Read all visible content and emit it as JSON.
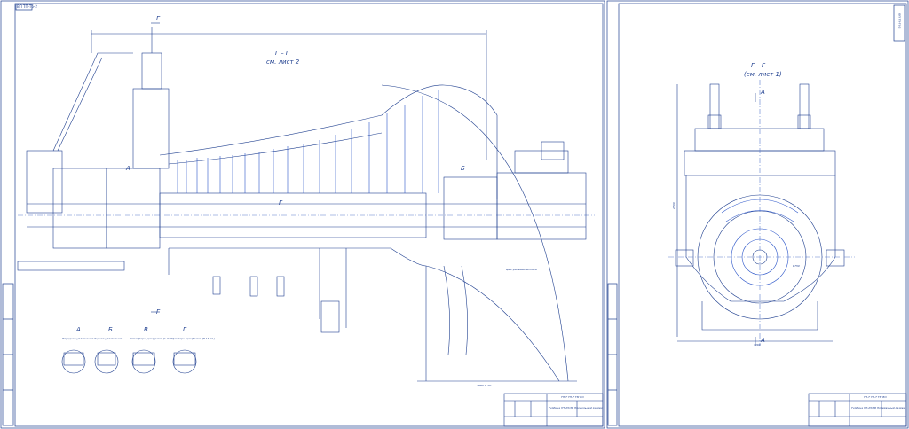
{
  "sheet1": {
    "top_code": "ВП ТП-Т6-2",
    "section_title_line1": "Г – Г",
    "section_title_line2": "см. лист 2",
    "section_marks": {
      "g_top": "Г",
      "g_bottom": "Г",
      "a": "А",
      "b": "Б",
      "g_mid": "Г"
    },
    "detail_labels": [
      {
        "letter": "А",
        "caption": "Переднее уплотнение"
      },
      {
        "letter": "Б",
        "caption": "Заднее уплотнение"
      },
      {
        "letter": "В",
        "caption": "Атмосферн. диафрагм. (1-7 ст.)"
      },
      {
        "letter": "Г",
        "caption": "Атмосферн. диафрагм. (8-16 ст.)"
      }
    ],
    "right_annotation": "Центральный шпонка",
    "dimension_bottom": "2880 ± 2%",
    "title_block": {
      "doc_code": "ТП-Т ТП-Т ТМ ВО",
      "name": "Турбина ПТ-25/3Б Продольный разрез"
    }
  },
  "sheet2": {
    "top_code": "ВП ТП-Т6-2",
    "section_title_line1": "Г – Г",
    "section_title_line2": "(см. лист 1)",
    "section_marks": {
      "a_top": "А",
      "a_bottom": "А"
    },
    "dimension_left": "2700",
    "dimension_bottom": "3060",
    "dimension_right": "R750",
    "title_block": {
      "doc_code": "ТП-Т ТП-Т ТМ ВО",
      "name": "Турбина ПТ-25/3Б Поперечный разрез"
    }
  },
  "colors": {
    "line": "#1f3f8f",
    "line_light": "#5b7ccc",
    "accent": "#2b55c9"
  }
}
